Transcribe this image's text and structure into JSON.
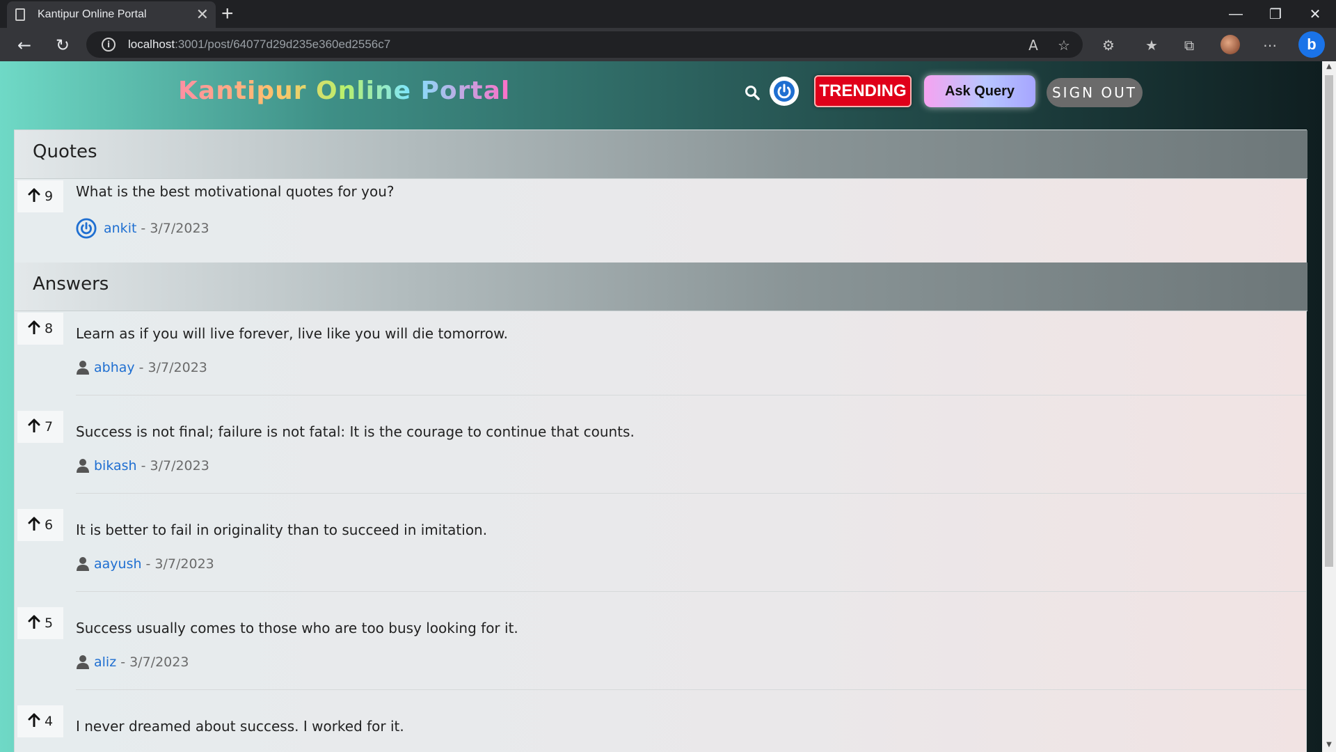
{
  "browser": {
    "tab_title": "Kantipur Online Portal",
    "url_host": "localhost",
    "url_path": ":3001/post/64077d29d235e360ed2556c7"
  },
  "header": {
    "logo": "Kantipur Online Portal",
    "trending_label": "TRENDING",
    "ask_label": "Ask Query",
    "signout_label": "SIGN OUT"
  },
  "question_section": {
    "title": "Quotes",
    "votes": "9",
    "text": "What is the best motivational quotes for you?",
    "author": "ankit",
    "date": "- 3/7/2023"
  },
  "answers_section": {
    "title": "Answers",
    "items": [
      {
        "votes": "8",
        "text": "Learn as if you will live forever, live like you will die tomorrow.",
        "author": "abhay",
        "date": "- 3/7/2023"
      },
      {
        "votes": "7",
        "text": "Success is not final; failure is not fatal: It is the courage to continue that counts.",
        "author": "bikash",
        "date": "- 3/7/2023"
      },
      {
        "votes": "6",
        "text": "It is better to fail in originality than to succeed in imitation.",
        "author": "aayush",
        "date": "- 3/7/2023"
      },
      {
        "votes": "5",
        "text": "Success usually comes to those who are too busy looking for it.",
        "author": "aliz",
        "date": "- 3/7/2023"
      },
      {
        "votes": "4",
        "text": "I never dreamed about success. I worked for it.",
        "author": "",
        "date": ""
      }
    ]
  }
}
